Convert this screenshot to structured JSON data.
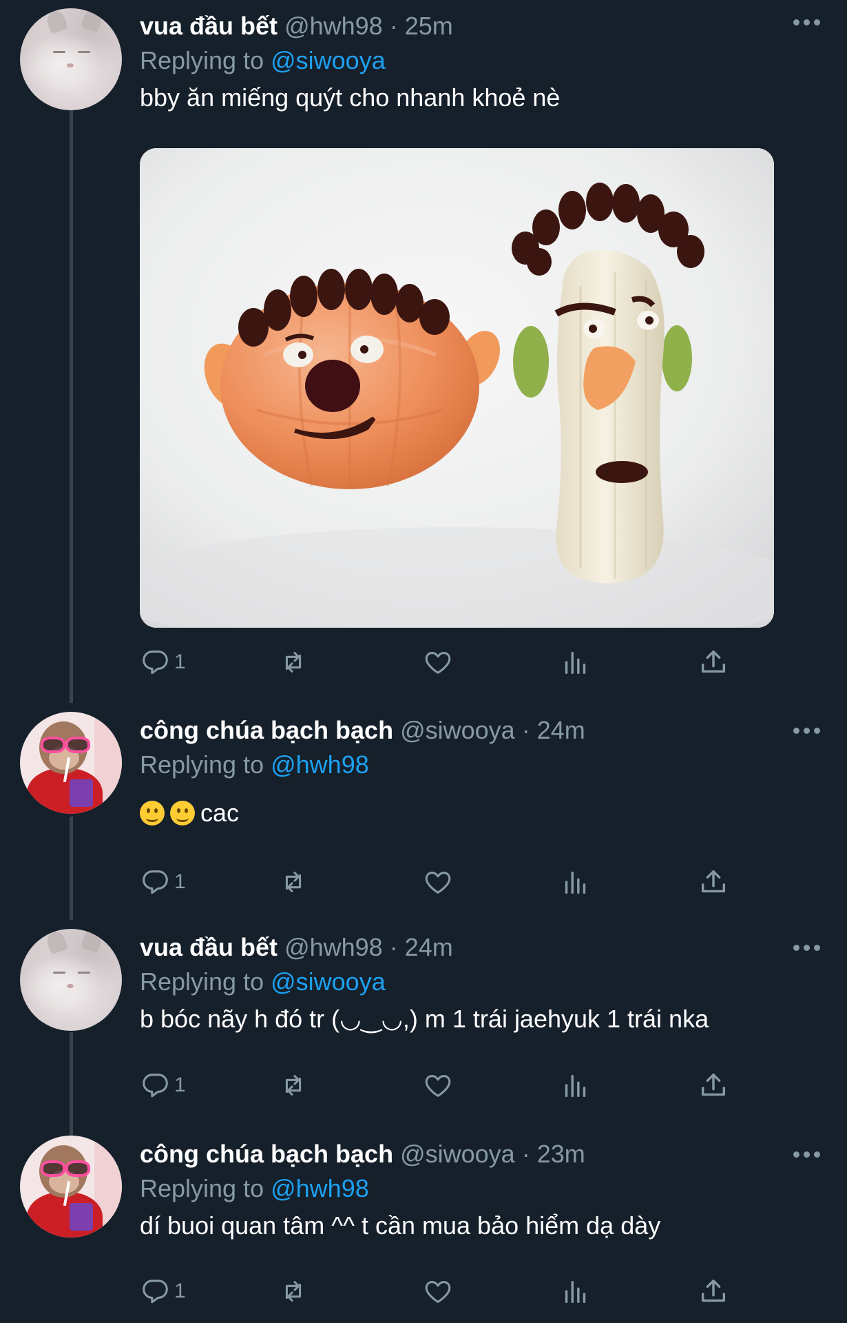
{
  "tweets": [
    {
      "name": "vua đầu bết",
      "handle": "@hwh98",
      "dot": " · ",
      "time": "25m",
      "replying_prefix": "Replying to ",
      "replying_to": "@siwooya",
      "text": "bby ăn miếng quýt cho nhanh khoẻ nè",
      "reply_count": "1",
      "has_media": true
    },
    {
      "name": "công chúa bạch bạch",
      "handle": "@siwooya",
      "dot": " · ",
      "time": "24m",
      "replying_prefix": "Replying to ",
      "replying_to": "@hwh98",
      "text": "cac",
      "reply_count": "1"
    },
    {
      "name": "vua đầu bết",
      "handle": "@hwh98",
      "dot": " · ",
      "time": "24m",
      "replying_prefix": "Replying to ",
      "replying_to": "@siwooya",
      "text": "b bóc nãy h đó tr (◡‿◡,) m 1 trái jaehyuk 1 trái nka",
      "reply_count": "1"
    },
    {
      "name": "công chúa bạch bạch",
      "handle": "@siwooya",
      "dot": " · ",
      "time": "23m",
      "replying_prefix": "Replying to ",
      "replying_to": "@hwh98",
      "text": "dí buoi quan tâm ^^ t cần mua bảo hiểm dạ dày",
      "reply_count": "1"
    }
  ],
  "icons": {
    "reply": "reply-icon",
    "retweet": "retweet-icon",
    "like": "heart-icon",
    "analytics": "analytics-icon",
    "share": "share-icon",
    "more": "more-icon"
  },
  "colors": {
    "background": "#15202b",
    "secondary_text": "#8899a6",
    "link": "#1da1f2",
    "thread_line": "#38444d"
  }
}
